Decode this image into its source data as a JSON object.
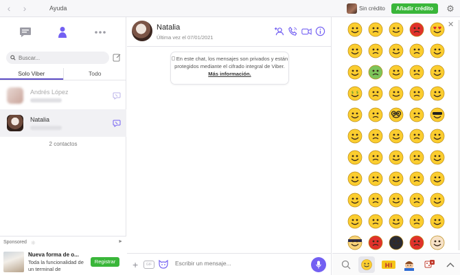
{
  "topbar": {
    "back_icon": "chevron-left-icon",
    "forward_icon": "chevron-right-icon",
    "menu_help": "Ayuda",
    "credit_status": "Sin crédito",
    "add_credit_label": "Añadir crédito",
    "settings_icon": "gear-icon"
  },
  "left": {
    "tabs": [
      "chat-icon",
      "contacts-icon",
      "more-icon"
    ],
    "search_placeholder": "Buscar...",
    "filters": [
      "Solo Viber",
      "Todo"
    ],
    "contacts": [
      {
        "name": "Andrés López"
      },
      {
        "name": "Natalia"
      }
    ],
    "contacts_count": "2 contactos",
    "sponsored": {
      "label": "Sponsored",
      "title": "Nueva forma de o...",
      "text": "Toda la funcionalidad de un terminal de",
      "button": "Registrar"
    }
  },
  "chat": {
    "name": "Natalia",
    "last_seen": "Última vez el 07/01/2021",
    "notice_text": "En este chat, los mensajes son privados y están protegidos mediante el cifrado integral de Viber.",
    "notice_link": "Más información.",
    "composer_placeholder": "Escribir un mensaje...",
    "gif_label": "GIF"
  },
  "emoji": {
    "close_icon": "close-icon",
    "faces": [
      "smile",
      "worried",
      "wink",
      "angry-devil",
      "heart-eyes",
      "tongue",
      "grin",
      "shock",
      "kiss",
      "smirk",
      "cry",
      "sick",
      "confused",
      "laugh",
      "tongue-wink",
      "money",
      "sly",
      "eyebrow",
      "blush",
      "pout",
      "sleepy",
      "crazy",
      "nerd",
      "happy",
      "cool",
      "silly",
      "laugh-tears",
      "heart",
      "scream",
      "grimace",
      "dizzy",
      "dead",
      "surprised",
      "blush-smile",
      "hmm",
      "flushed",
      "stare",
      "shocked",
      "upset",
      "tongue-out",
      "frown",
      "angry",
      "sad",
      "unsure",
      "squint",
      "meh",
      "sweat",
      "sob",
      "rolling",
      "smug",
      "ninja",
      "red-angry",
      "cat-devil",
      "devil",
      "angel"
    ],
    "hearts": [
      "#e5243b",
      "#c9182c",
      "#7f3cb3",
      "#f5c518",
      "#57b5d6"
    ],
    "footer": [
      "search-icon",
      "smiley-tab",
      "hiii-sticker",
      "boy-sticker",
      "dice-sticker",
      "chevron-up-icon"
    ]
  },
  "colors": {
    "viber_purple": "#7360f2",
    "green": "#3ab63a",
    "emoji_yellow": "#fbcd2f"
  }
}
